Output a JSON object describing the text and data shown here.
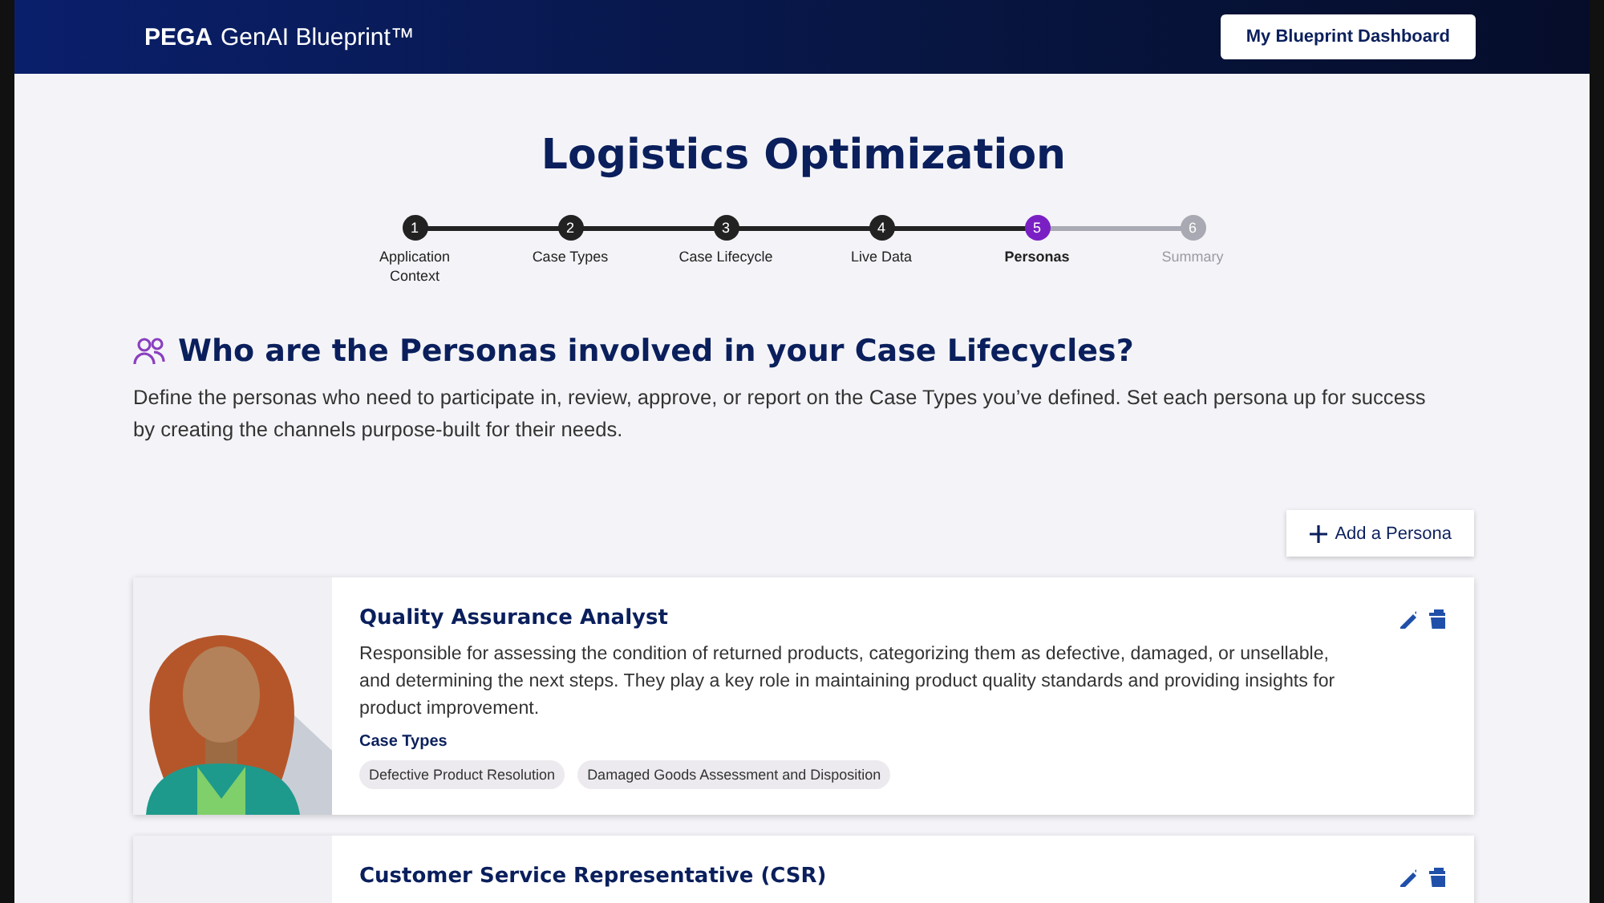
{
  "header": {
    "brand_bold": "PEGA",
    "brand_rest": "GenAI Blueprint™",
    "dashboard_button": "My Blueprint Dashboard"
  },
  "title": "Logistics Optimization",
  "steps": [
    {
      "number": "1",
      "label": "Application Context",
      "completed": true,
      "selected": false
    },
    {
      "number": "2",
      "label": "Case Types",
      "completed": true,
      "selected": false
    },
    {
      "number": "3",
      "label": "Case Lifecycle",
      "completed": true,
      "selected": false
    },
    {
      "number": "4",
      "label": "Live Data",
      "completed": true,
      "selected": false
    },
    {
      "number": "5",
      "label": "Personas",
      "completed": false,
      "selected": true
    },
    {
      "number": "6",
      "label": "Summary",
      "completed": false,
      "selected": false
    }
  ],
  "section": {
    "heading": "Who are the Personas involved in your Case Lifecycles?",
    "description": "Define the personas who need to participate in, review, approve, or report on the Case Types you’ve defined. Set each persona up for success by creating the channels purpose-built for their needs.",
    "add_button": "Add a Persona"
  },
  "personas": [
    {
      "name": "Quality Assurance Analyst",
      "description": "Responsible for assessing the condition of returned products, categorizing them as defective, damaged, or unsellable, and determining the next steps. They play a key role in maintaining product quality standards and providing insights for product improvement.",
      "case_types_label": "Case Types",
      "case_types": [
        "Defective Product Resolution",
        "Damaged Goods Assessment and Disposition"
      ]
    },
    {
      "name": "Customer Service Representative (CSR)"
    }
  ]
}
